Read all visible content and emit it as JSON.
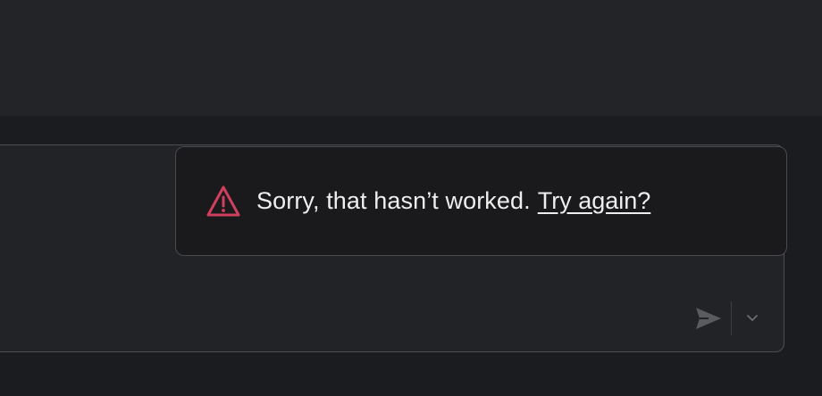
{
  "toast": {
    "message": "Sorry, that hasn’t worked.",
    "retry_link": "Try again?",
    "icon": "warning-triangle-icon",
    "icon_color": "#d0405e"
  },
  "composer": {
    "send_icon": "send-icon",
    "options_icon": "chevron-down-icon"
  },
  "colors": {
    "background": "#1b1c1f",
    "top_panel": "#232428",
    "composer_bg": "#222327",
    "toast_bg": "#1a1a1c"
  }
}
